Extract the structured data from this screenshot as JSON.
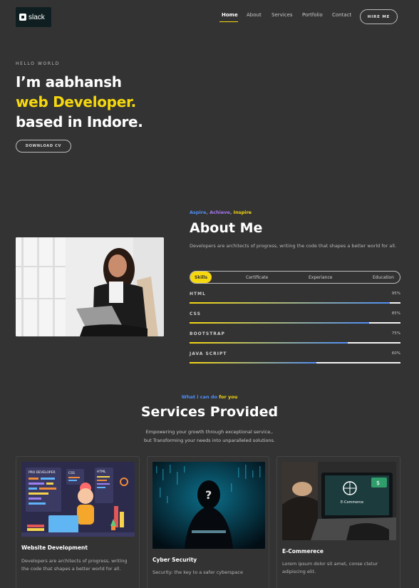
{
  "nav": {
    "logo_text": "slack",
    "links": [
      "Home",
      "About",
      "Services",
      "Portfolio",
      "Contact"
    ],
    "active": "Home",
    "hire_label": "HIRE ME"
  },
  "hero": {
    "eyebrow": "HELLO WORLD",
    "line1": "I’m aabhansh",
    "line2": "web Developer.",
    "line3": "based in Indore.",
    "cta": "DOWNLOAD CV"
  },
  "about": {
    "tagline": {
      "w1": "Aspire",
      "sep1": ", ",
      "w2": "Achieve",
      "sep2": ", ",
      "w3": "Inspire"
    },
    "title": "About Me",
    "desc": "Developers are architects of progress, writing the code that shapes a better world for all.",
    "tabs": [
      "Skills",
      "Certificate",
      "Experiance",
      "Education"
    ],
    "active_tab": "Skills",
    "skills": [
      {
        "name": "HTML",
        "percent": "95%",
        "value": 95
      },
      {
        "name": "CSS",
        "percent": "85%",
        "value": 85
      },
      {
        "name": "BOOTSTRAP",
        "percent": "75%",
        "value": 75
      },
      {
        "name": "JAVA SCRIPT",
        "percent": "60%",
        "value": 60
      }
    ]
  },
  "services": {
    "eyebrow_a": "What i can do",
    "eyebrow_b": " for you",
    "title": "Services Provided",
    "desc_line1": "Empowering your growth through exceptional service,.",
    "desc_line2": "but Transforming your needs into unparalleled solutions.",
    "cards": [
      {
        "title": "Website Development",
        "desc": "Developers are architects of progress, writing the code that shapes a better world for all."
      },
      {
        "title": "Cyber Security",
        "desc": "Security: the key to a safer cyberspace"
      },
      {
        "title": "E-Commerece",
        "desc": "Lorem ipsum dolor sit amet, conse ctetur adipiscing elit."
      }
    ],
    "illustration_labels": {
      "a": "PRO DEVELOPER",
      "b": "CSS",
      "c": "HTML",
      "d": "E-Commerce"
    }
  },
  "colors": {
    "accent_yellow": "#f6d80e",
    "accent_blue": "#4f8ff7",
    "accent_purple": "#a676f0",
    "background": "#333333"
  }
}
